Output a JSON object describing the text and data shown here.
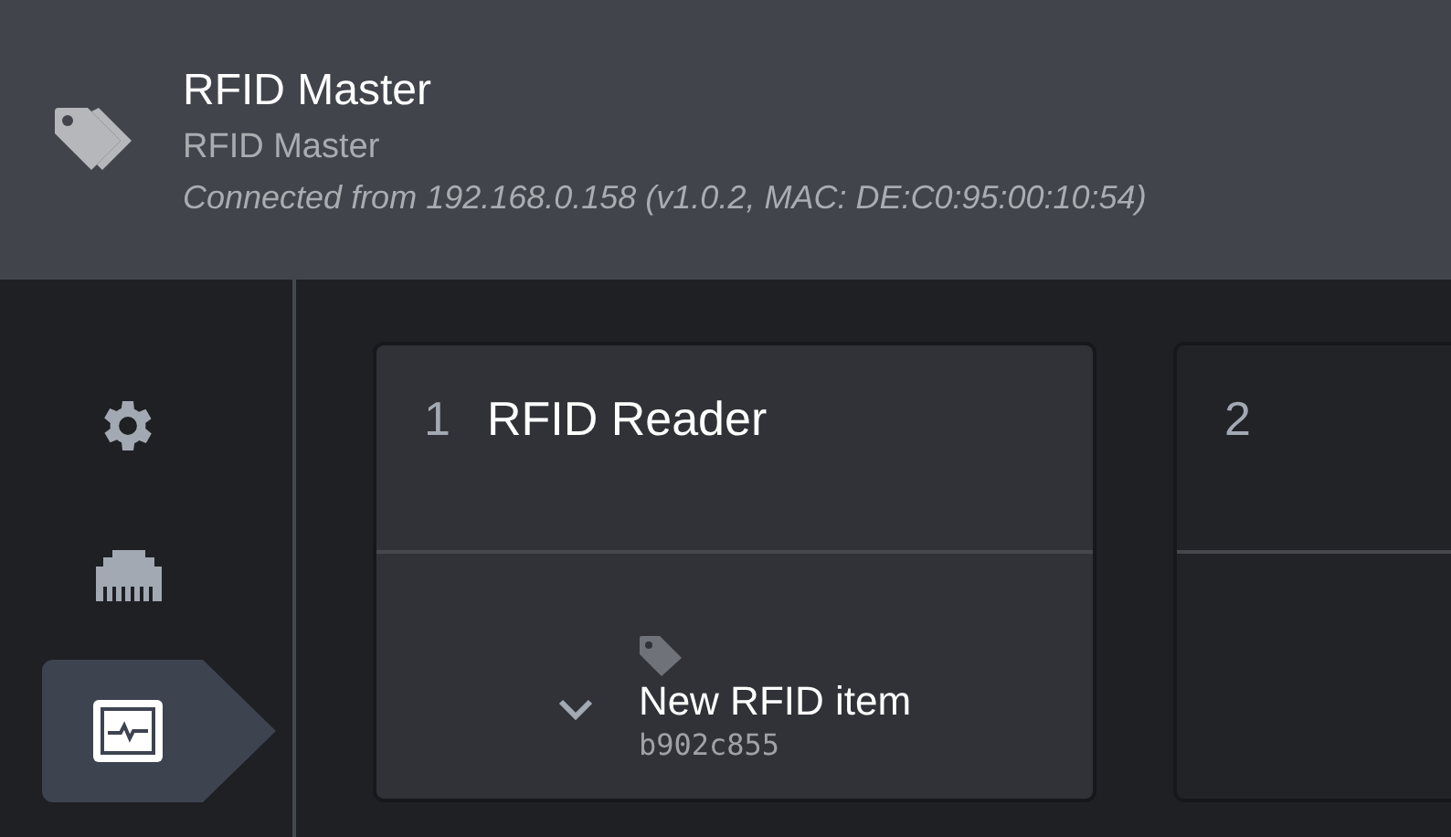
{
  "header": {
    "title": "RFID Master",
    "subtitle": "RFID Master",
    "connection": "Connected from 192.168.0.158 (v1.0.2, MAC: DE:C0:95:00:10:54)"
  },
  "sidebar": {
    "items": [
      {
        "kind": "settings",
        "selected": false
      },
      {
        "kind": "network",
        "selected": false
      },
      {
        "kind": "monitor",
        "selected": true
      }
    ]
  },
  "slots": [
    {
      "number": "1",
      "title": "RFID Reader",
      "selected": true,
      "items": [
        {
          "name": "New RFID item",
          "id": "b902c855"
        }
      ]
    },
    {
      "number": "2",
      "selected": false
    }
  ]
}
